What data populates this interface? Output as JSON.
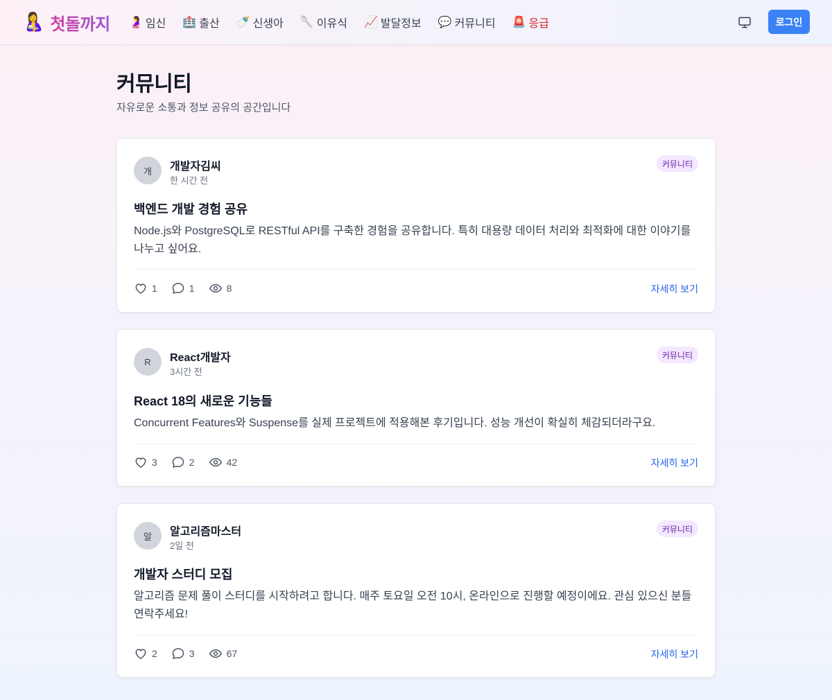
{
  "brand": {
    "emoji": "🤱",
    "name": "첫돌까지"
  },
  "nav": {
    "items": [
      {
        "icon": "🤰",
        "label": "임신"
      },
      {
        "icon": "🏥",
        "label": "출산"
      },
      {
        "icon": "🍼",
        "label": "신생아"
      },
      {
        "icon": "🥄",
        "label": "이유식"
      },
      {
        "icon": "📈",
        "label": "발달정보"
      },
      {
        "icon": "💬",
        "label": "커뮤니티"
      },
      {
        "icon": "🚨",
        "label": "응급"
      }
    ]
  },
  "header": {
    "login_label": "로그인",
    "theme_icon": "monitor-icon"
  },
  "page": {
    "title": "커뮤니티",
    "subtitle": "자유로운 소통과 정보 공유의 공간입니다"
  },
  "posts": [
    {
      "avatar": "개",
      "author": "개발자김씨",
      "time": "한 시간 전",
      "category": "커뮤니티",
      "title": "백엔드 개발 경험 공유",
      "body": "Node.js와 PostgreSQL로 RESTful API를 구축한 경험을 공유합니다. 특히 대용량 데이터 처리와 최적화에 대한 이야기를 나누고 싶어요.",
      "likes": "1",
      "comments": "1",
      "views": "8",
      "detail_label": "자세히 보기"
    },
    {
      "avatar": "R",
      "author": "React개발자",
      "time": "3시간 전",
      "category": "커뮤니티",
      "title": "React 18의 새로운 기능들",
      "body": "Concurrent Features와 Suspense를 실제 프로젝트에 적용해본 후기입니다. 성능 개선이 확실히 체감되더라구요.",
      "likes": "3",
      "comments": "2",
      "views": "42",
      "detail_label": "자세히 보기"
    },
    {
      "avatar": "알",
      "author": "알고리즘마스터",
      "time": "2일 전",
      "category": "커뮤니티",
      "title": "개발자 스터디 모집",
      "body": "알고리즘 문제 풀이 스터디를 시작하려고 합니다. 매주 토요일 오전 10시, 온라인으로 진행할 예정이에요. 관심 있으신 분들 연락주세요!",
      "likes": "2",
      "comments": "3",
      "views": "67",
      "detail_label": "자세히 보기"
    }
  ],
  "colors": {
    "brand_gradient_start": "#d03f9c",
    "brand_gradient_end": "#9a55d7",
    "primary": "#3b82f6",
    "link": "#2563eb",
    "emergency": "#dc2626",
    "badge_bg": "#f3e8ff",
    "badge_text": "#6b21a8"
  }
}
